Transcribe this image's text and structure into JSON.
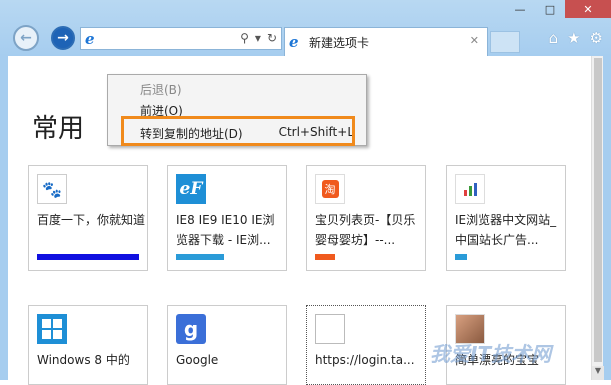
{
  "window": {
    "minimize": "—",
    "maximize": "□",
    "close": "✕"
  },
  "nav": {
    "back_icon": "←",
    "forward_icon": "→"
  },
  "address": {
    "value": "",
    "logo": "e",
    "search_icon": "⚲",
    "dropdown_icon": "▾",
    "refresh_icon": "↻"
  },
  "tab": {
    "title": "新建选项卡",
    "close": "✕"
  },
  "tools": {
    "home_icon": "⌂",
    "favorites_icon": "★",
    "settings_icon": "⚙"
  },
  "page": {
    "heading": "常用"
  },
  "context_menu": {
    "items": [
      {
        "label": "后退(B)",
        "shortcut": "",
        "disabled": true
      },
      {
        "label": "前进(O)",
        "shortcut": "",
        "disabled": false
      },
      {
        "label": "转到复制的地址(D)",
        "shortcut": "Ctrl+Shift+L",
        "disabled": false
      }
    ]
  },
  "tiles": [
    {
      "label": "百度一下，你就知道",
      "bar_color": "#1010e0",
      "icon_color": "#2d4fd4",
      "icon": "paw-icon"
    },
    {
      "label": "IE8 IE9 IE10 IE浏览器下载 - IE浏...",
      "bar_color": "#2a9bd8",
      "icon_color": "#1e8fd6",
      "icon": "ie-logo-icon"
    },
    {
      "label": "宝贝列表页-【贝乐婴母婴坊】--...",
      "bar_color": "#f05a1e",
      "icon_color": "#f05a1e",
      "icon": "taobao-icon"
    },
    {
      "label": "IE浏览器中文网站_中国站长广告...",
      "bar_color": "#2a9bd8",
      "icon_color": "#3a9a3a",
      "icon": "chart-icon"
    },
    {
      "label": "Windows 8 中的",
      "bar_color": "",
      "icon_color": "#1e8fd6",
      "icon": "windows-icon"
    },
    {
      "label": "Google",
      "bar_color": "",
      "icon_color": "#3b6fd8",
      "icon": "google-icon"
    },
    {
      "label": "https://login.ta...",
      "bar_color": "",
      "icon_color": "#ffffff",
      "icon": "blank-icon"
    },
    {
      "label": "简单漂亮的宝宝",
      "bar_color": "",
      "icon_color": "#c08060",
      "icon": "photo-icon"
    }
  ],
  "watermark": "我爱IT技术网"
}
